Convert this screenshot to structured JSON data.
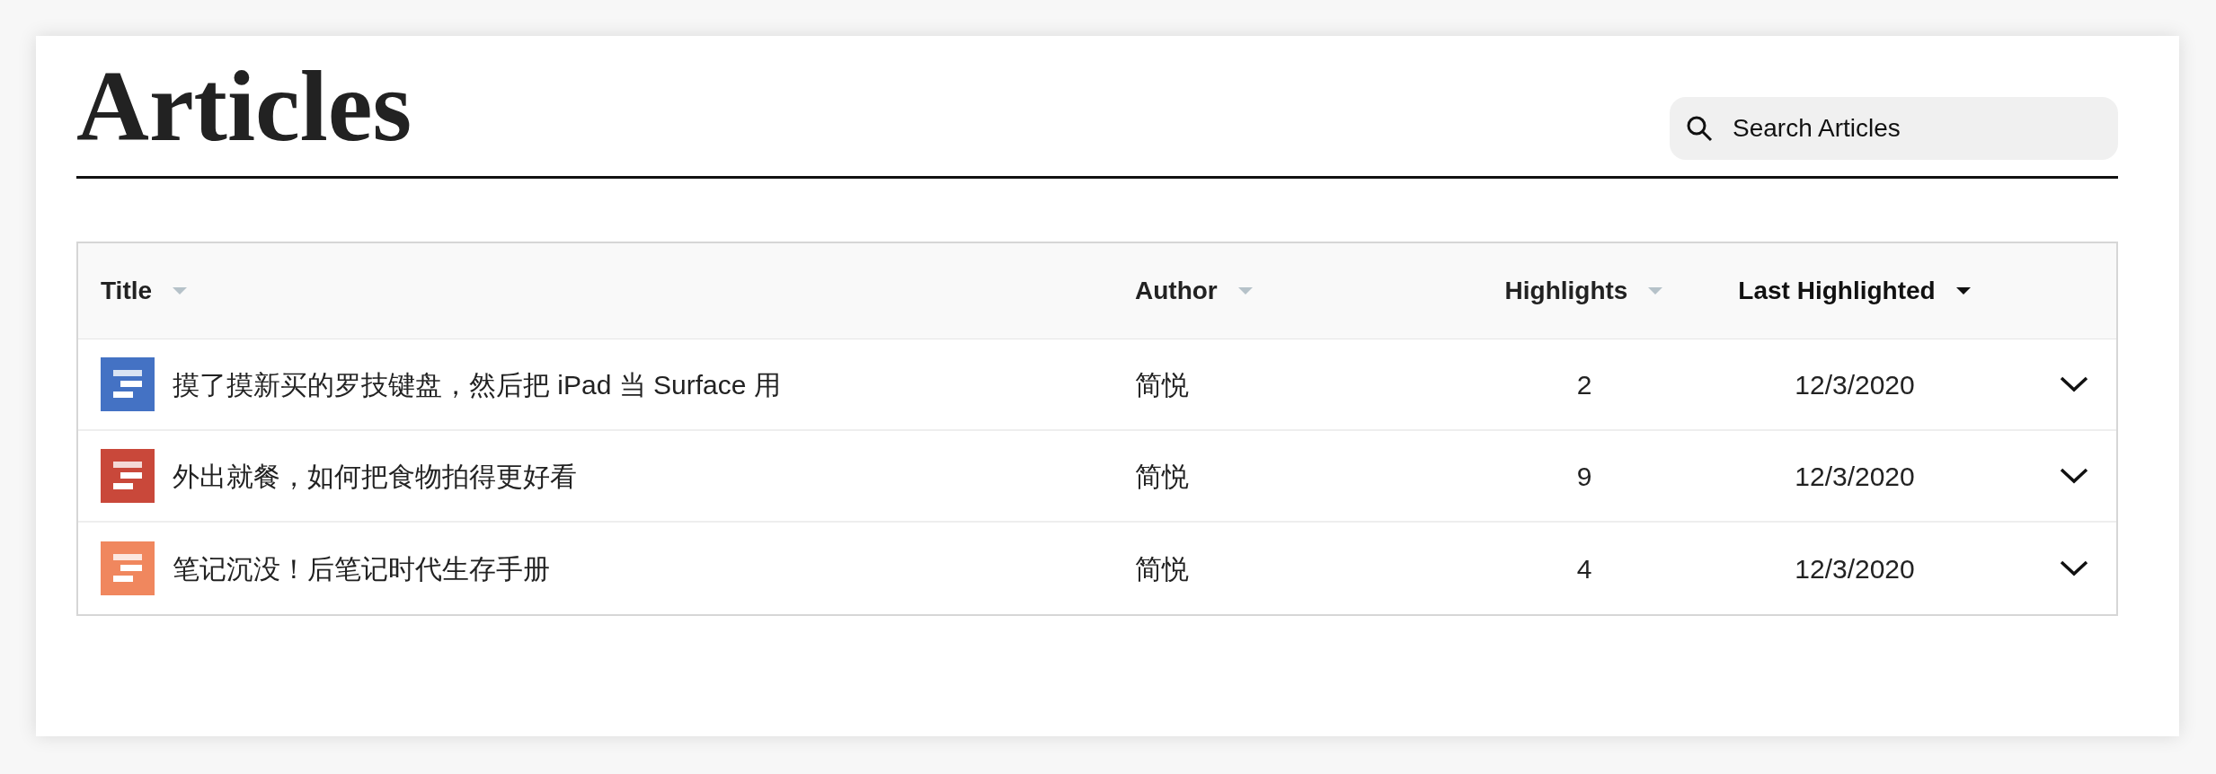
{
  "page": {
    "title": "Articles"
  },
  "search": {
    "placeholder": "Search Articles"
  },
  "table": {
    "columns": [
      {
        "label": "Title",
        "selected": false
      },
      {
        "label": "Author",
        "selected": false
      },
      {
        "label": "Highlights",
        "selected": false
      },
      {
        "label": "Last Highlighted",
        "selected": true
      }
    ],
    "rows": [
      {
        "title": "摸了摸新买的罗技键盘，然后把 iPad 当 Surface 用",
        "color": "#4472c4",
        "author": "简悦",
        "highlights": "2",
        "last_highlighted": "12/3/2020"
      },
      {
        "title": "外出就餐，如何把食物拍得更好看",
        "color": "#c9483a",
        "author": "简悦",
        "highlights": "9",
        "last_highlighted": "12/3/2020"
      },
      {
        "title": "笔记沉没！后笔记时代生存手册",
        "color": "#f0875e",
        "author": "简悦",
        "highlights": "4",
        "last_highlighted": "12/3/2020"
      }
    ]
  }
}
